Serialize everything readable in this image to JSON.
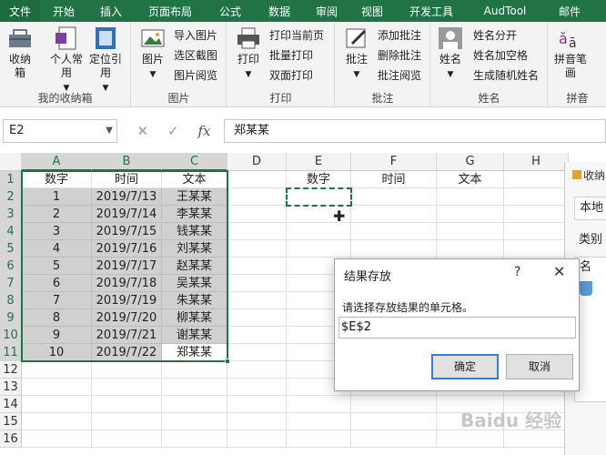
{
  "tabs": [
    "文件",
    "开始",
    "插入",
    "页面布局",
    "公式",
    "数据",
    "审阅",
    "视图",
    "开发工具",
    "AudTool",
    "邮件"
  ],
  "ribbon": {
    "groups": [
      {
        "label": "我的收纳箱",
        "big": [
          "收纳箱",
          "个人常用",
          "定位引用"
        ]
      },
      {
        "label": "图片",
        "big": [
          "图片"
        ],
        "small": [
          "导入图片",
          "选区截图",
          "图片阅览"
        ]
      },
      {
        "label": "打印",
        "big": [
          "打印"
        ],
        "small": [
          "打印当前页",
          "批量打印",
          "双面打印"
        ]
      },
      {
        "label": "批注",
        "big": [
          "批注"
        ],
        "small": [
          "添加批注",
          "删除批注",
          "批注阅览"
        ]
      },
      {
        "label": "姓名",
        "big": [
          "姓名"
        ],
        "small": [
          "姓名分开",
          "姓名加空格",
          "生成随机姓名"
        ]
      },
      {
        "label": "拼音",
        "big": [
          "拼音笔画"
        ]
      }
    ]
  },
  "formula": {
    "namebox": "E2",
    "content": "郑某某",
    "cancel_icon": "✕",
    "enter_icon": "✓",
    "fx": "fx"
  },
  "columns": [
    "A",
    "B",
    "C",
    "D",
    "E",
    "F",
    "G",
    "H"
  ],
  "rows": [
    "1",
    "2",
    "3",
    "4",
    "5",
    "6",
    "7",
    "8",
    "9",
    "10",
    "11",
    "12",
    "13",
    "14",
    "15",
    "16"
  ],
  "table": {
    "headers": [
      "数字",
      "时间",
      "文本"
    ],
    "data": [
      [
        "1",
        "2019/7/13",
        "王某某"
      ],
      [
        "2",
        "2019/7/14",
        "李某某"
      ],
      [
        "3",
        "2019/7/15",
        "钱某某"
      ],
      [
        "4",
        "2019/7/16",
        "刘某某"
      ],
      [
        "5",
        "2019/7/17",
        "赵某某"
      ],
      [
        "6",
        "2019/7/18",
        "吴某某"
      ],
      [
        "7",
        "2019/7/19",
        "朱某某"
      ],
      [
        "8",
        "2019/7/20",
        "柳某某"
      ],
      [
        "9",
        "2019/7/21",
        "谢某某"
      ],
      [
        "10",
        "2019/7/22",
        "郑某某"
      ]
    ]
  },
  "target_headers": [
    "数字",
    "时间",
    "文本"
  ],
  "side_panel": {
    "title": "收纳",
    "local": "本地",
    "category": "类别",
    "name": "名"
  },
  "dialog": {
    "title": "结果存放",
    "help": "?",
    "close": "✕",
    "prompt": "请选择存放结果的单元格。",
    "value": "$E$2",
    "ok": "确定",
    "cancel": "取消"
  },
  "watermark": "Baidu 经验",
  "colors": {
    "accent": "#217346",
    "selection": "#d0d0d0"
  }
}
